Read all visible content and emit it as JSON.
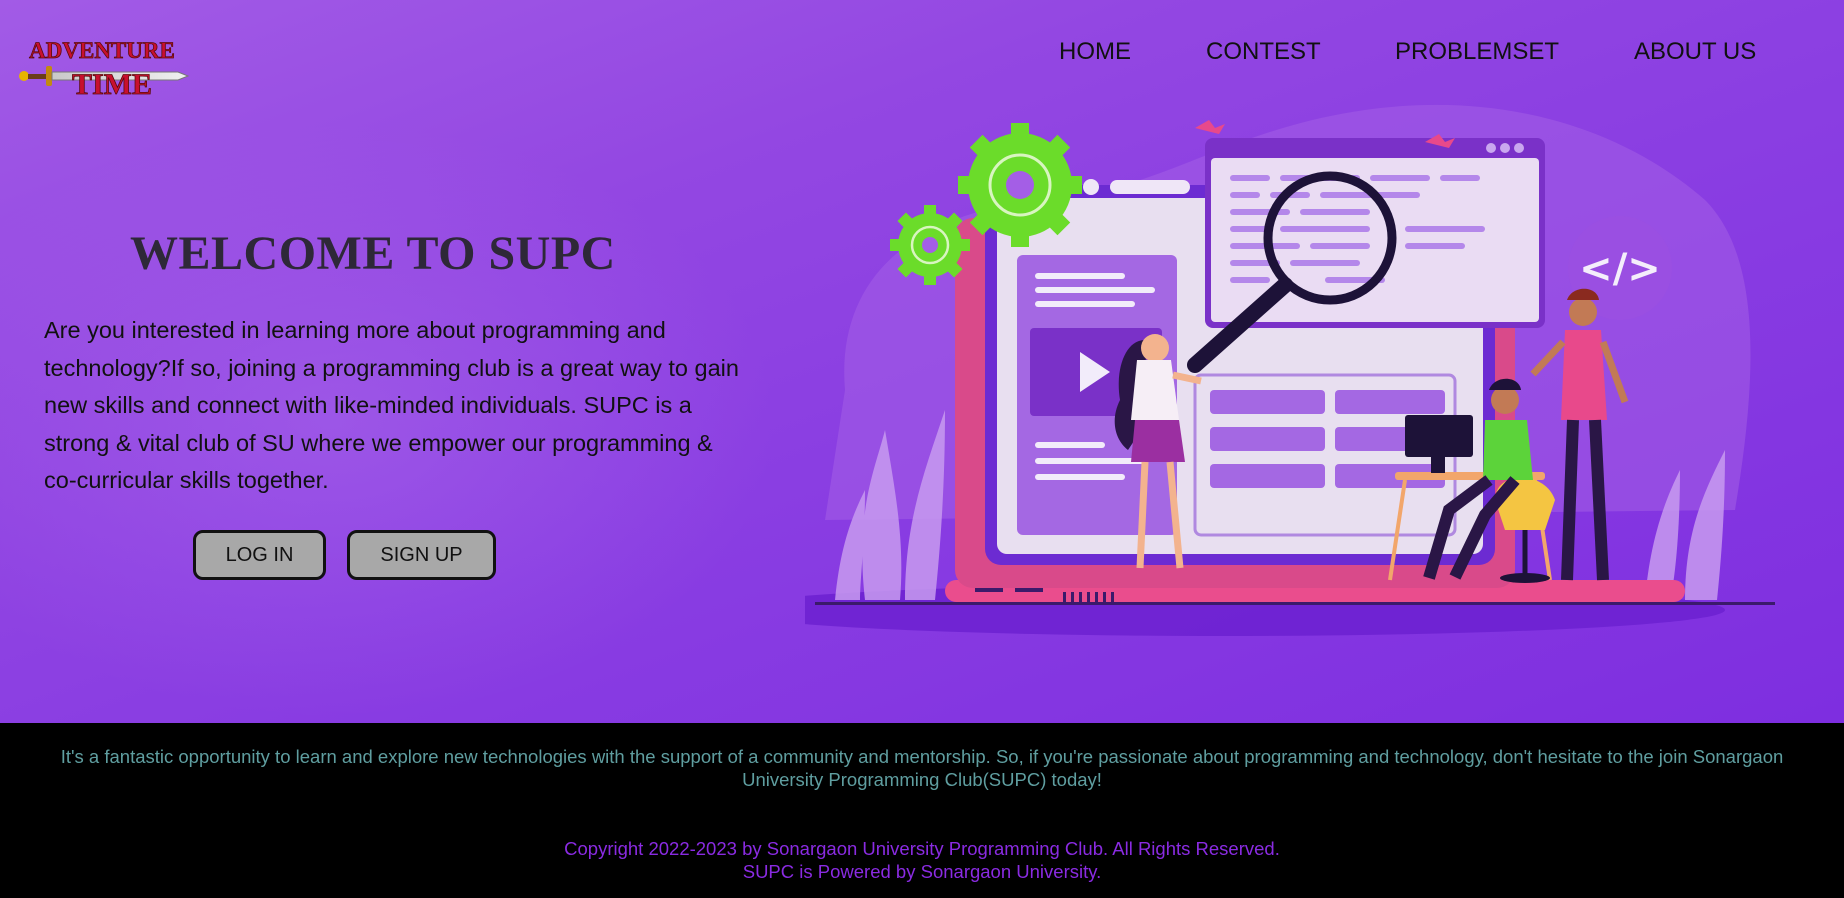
{
  "brand": {
    "logo_line1": "ADVENTURE",
    "logo_line2": "TIME"
  },
  "nav": {
    "items": [
      {
        "label": "HOME"
      },
      {
        "label": "CONTEST"
      },
      {
        "label": "PROBLEMSET"
      },
      {
        "label": "ABOUT US"
      }
    ]
  },
  "hero": {
    "title": "WELCOME TO SUPC",
    "description": "Are you interested in learning more about programming and technology?If so, joining a programming club is a great way to gain new skills and connect with like-minded individuals. SUPC is a strong & vital club of SU where we empower our programming & co-curricular skills together.",
    "login_label": "LOG IN",
    "signup_label": "SIGN UP",
    "code_badge": "</>"
  },
  "footer": {
    "message": "It's a fantastic opportunity to learn and explore new technologies with the support of a community and mentorship. So, if you're passionate about programming and technology, don't hesitate to the join Sonargaon University Programming Club(SUPC) today!",
    "copyright": "Copyright 2022-2023 by Sonargaon University Programming Club. All Rights Reserved.",
    "powered": "SUPC is Powered by Sonargaon University."
  },
  "colors": {
    "hero_bg": "#8a3ee2",
    "footer_bg": "#000000",
    "footer_message": "#5f9ea0",
    "footer_copyright": "#8a2be2",
    "button_bg": "#a8a8a8"
  }
}
